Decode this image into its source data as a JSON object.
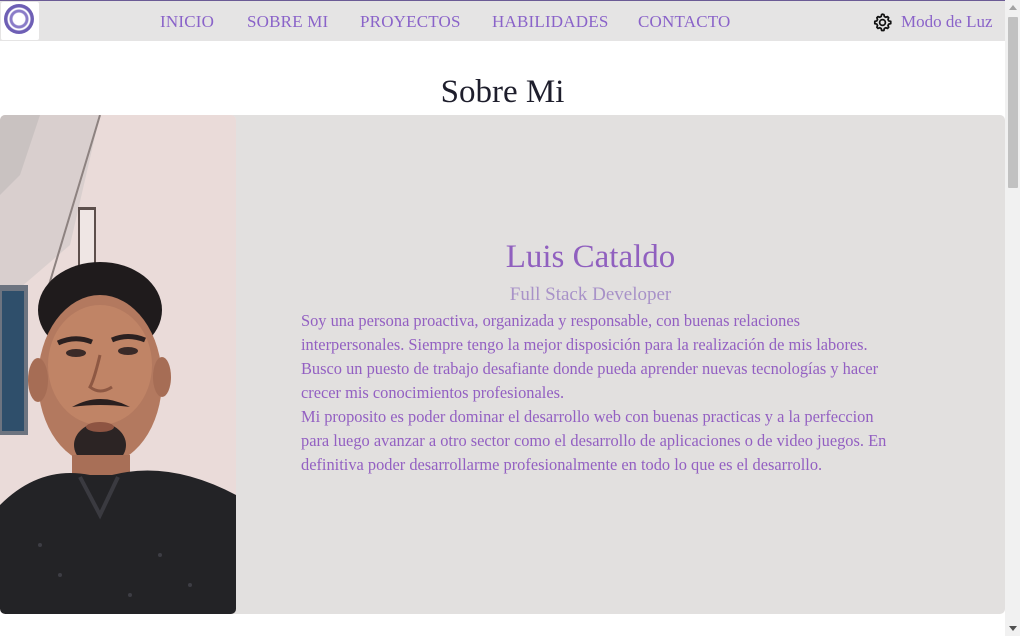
{
  "nav": {
    "links": [
      "INICIO",
      "SOBRE MI",
      "PROYECTOS",
      "HABILIDADES",
      "CONTACTO"
    ],
    "mode_label": "Modo de Luz",
    "mode_icon": "gear-icon"
  },
  "about": {
    "section_title": "Sobre Mi",
    "name": "Luis Cataldo",
    "role": "Full Stack Developer",
    "bio_1": "Soy una persona proactiva, organizada y responsable, con buenas relaciones interpersonales. Siempre tengo la mejor disposición para la realización de mis labores. Busco un puesto de trabajo desafiante donde pueda aprender nuevas tecnologías y hacer crecer mis conocimientos profesionales.",
    "bio_2": "Mi proposito es poder dominar el desarrollo web con buenas practicas y a la perfeccion para luego avanzar a otro sector como el desarrollo de aplicaciones o de video juegos. En definitiva poder desarrollarme profesionalmente en todo lo que es el desarrollo."
  },
  "colors": {
    "accent": "#8a63c9",
    "navbar_bg": "#e5e4e4",
    "card_bg": "#e2e0df",
    "title": "#1e1e2c"
  }
}
